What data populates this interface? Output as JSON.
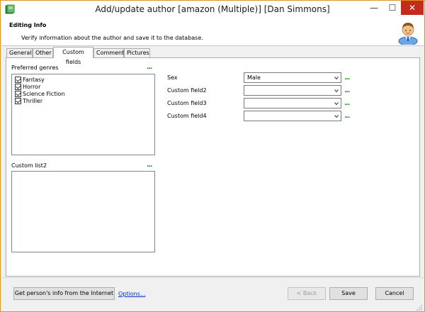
{
  "window": {
    "title": "Add/update author [amazon (Multiple)] [Dan Simmons]",
    "minimize_glyph": "—",
    "maximize_glyph": "☐",
    "close_glyph": "✕"
  },
  "header": {
    "title": "Editing Info",
    "subtitle": "Verify information about the author and save it to the database."
  },
  "tabs": [
    {
      "label": "General",
      "active": false
    },
    {
      "label": "Other",
      "active": false
    },
    {
      "label": "Custom fields",
      "active": true
    },
    {
      "label": "Comment",
      "active": false
    },
    {
      "label": "Pictures",
      "active": false
    }
  ],
  "custom_fields": {
    "preferred_genres_label": "Preferred genres",
    "genres": [
      {
        "label": "Fantasy",
        "checked": true
      },
      {
        "label": "Horror",
        "checked": true
      },
      {
        "label": "Science Fiction",
        "checked": true
      },
      {
        "label": "Thriller",
        "checked": true
      }
    ],
    "custom_list2_label": "Custom list2",
    "more_glyph": "...",
    "fields": [
      {
        "label": "Sex",
        "value": "Male"
      },
      {
        "label": "Custom field2",
        "value": ""
      },
      {
        "label": "Custom field3",
        "value": ""
      },
      {
        "label": "Custom field4",
        "value": ""
      }
    ]
  },
  "footer": {
    "get_info_label": "Get person's info from the Internet",
    "options_label": "Options...",
    "back_label": "< Back",
    "save_label": "Save",
    "cancel_label": "Cancel"
  },
  "colors": {
    "accent_border": "#d9962c",
    "close_button": "#c42b1c",
    "dots_green": "#1a8a1a",
    "link_blue": "#0033cc"
  }
}
